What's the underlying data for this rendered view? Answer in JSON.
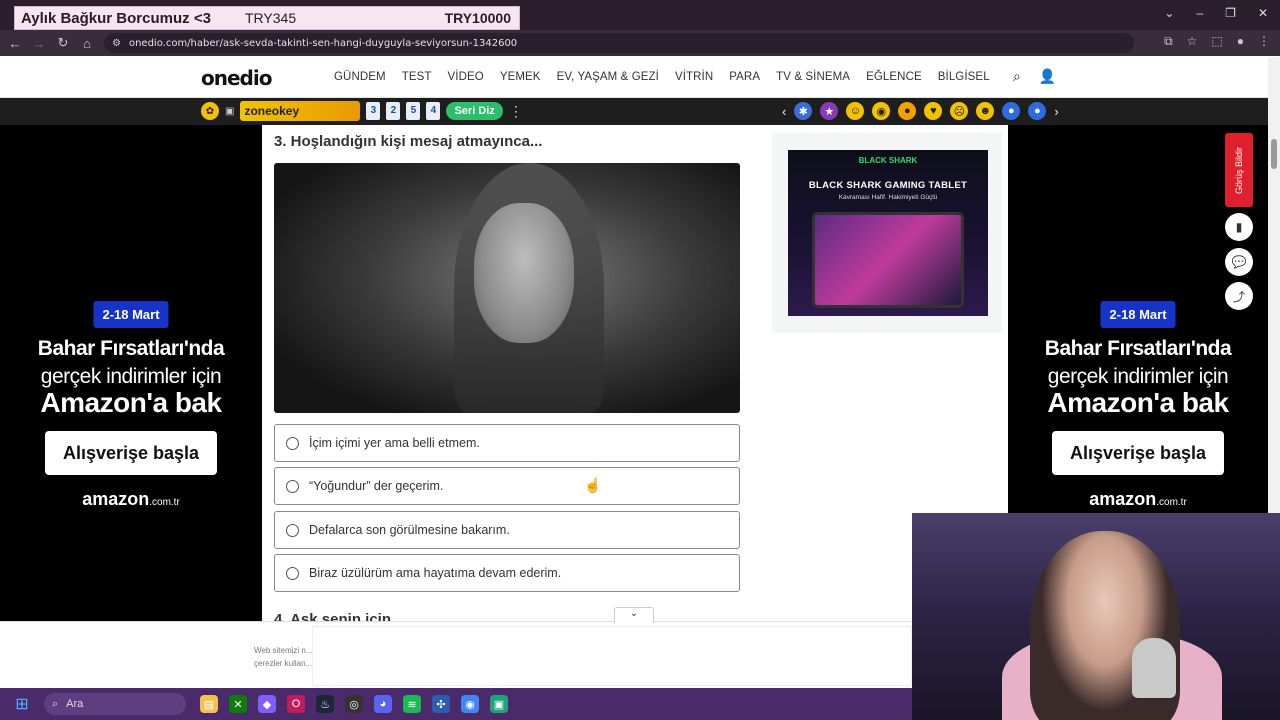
{
  "overlay": {
    "title": "Aylık Bağkur Borcumuz <3",
    "current": "TRY345",
    "goal": "TRY10000"
  },
  "browser": {
    "url": "onedio.com/haber/ask-sevda-takinti-sen-hangi-duyguyla-seviyorsun-1342600"
  },
  "site": {
    "logo": "onedio",
    "nav": [
      "GÜNDEM",
      "TEST",
      "VİDEO",
      "YEMEK",
      "EV, YAŞAM & GEZİ",
      "VİTRİN",
      "PARA",
      "TV & SİNEMA",
      "EĞLENCE",
      "BİLGİSEL"
    ]
  },
  "games_strip": {
    "zoneokey_label": "zoneokey",
    "tiles": [
      "3",
      "2",
      "5",
      "4"
    ],
    "seri_diz": "Seri Diz"
  },
  "side_ad": {
    "date": "2-18 Mart",
    "line1": "Bahar Fırsatları'nda",
    "line2": "gerçek indirimler için",
    "line3": "Amazon'a bak",
    "button": "Alışverişe başla",
    "brand": "amazon",
    "brand_suffix": ".com.tr"
  },
  "question": {
    "title": "3. Hoşlandığın kişi mesaj atmayınca...",
    "options": [
      "İçim içimi yer ama belli etmem.",
      "“Yoğundur” der geçerim.",
      "Defalarca son görülmesine bakarım.",
      "Biraz üzülürüm ama hayatıma devam ederim."
    ],
    "next_title": "4. Aşk senin için..."
  },
  "right_ad": {
    "logo": "BLACK SHARK",
    "title": "BLACK SHARK GAMING TABLET",
    "subtitle": "Kavraması Hafif. Hakimiyeti Güçlü"
  },
  "feedback": {
    "label": "Görüş Bildir"
  },
  "cookie": {
    "text": "Web sitemizi n... çerezler kullan..."
  },
  "taskbar": {
    "search_label": "Ara"
  }
}
